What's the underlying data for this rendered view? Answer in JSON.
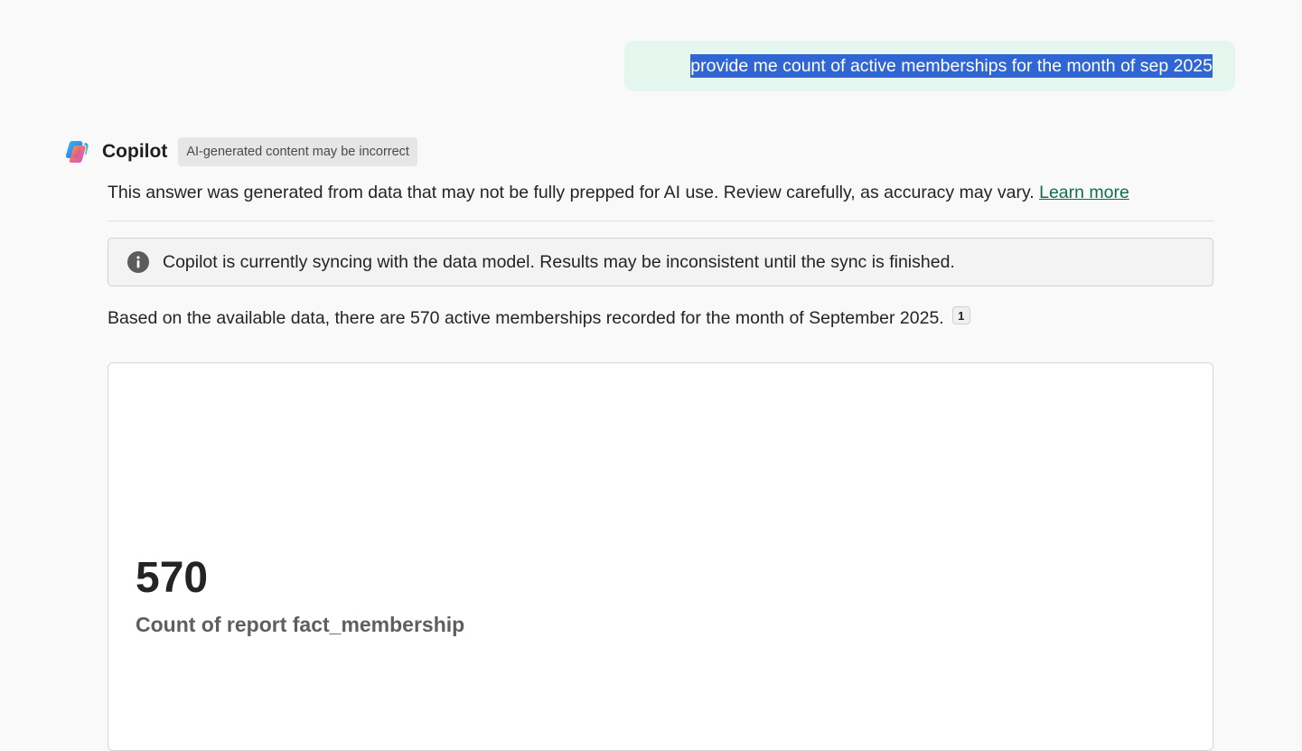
{
  "user_message": {
    "text": "provide me count of active memberships for the month of sep 2025"
  },
  "copilot": {
    "name": "Copilot",
    "badge": "AI-generated content may be incorrect",
    "logo_icon": "copilot-logo-icon"
  },
  "disclaimer": {
    "text": "This answer was generated from data that may not be fully prepped for AI use. Review carefully, as accuracy may vary. ",
    "link_label": "Learn more",
    "link_color": "#0e6d55"
  },
  "info_banner": {
    "icon": "info-icon",
    "text": "Copilot is currently syncing with the data model. Results may be inconsistent until the sync is finished."
  },
  "answer": {
    "text": "Based on the available data, there are 570 active memberships recorded for the month of September 2025.",
    "citation": "1"
  },
  "card": {
    "value": "570",
    "label": "Count of report fact_membership"
  },
  "colors": {
    "user_bubble": "#e4f6ee",
    "selection": "#2f66d4",
    "page_background": "#f9f9f9"
  }
}
